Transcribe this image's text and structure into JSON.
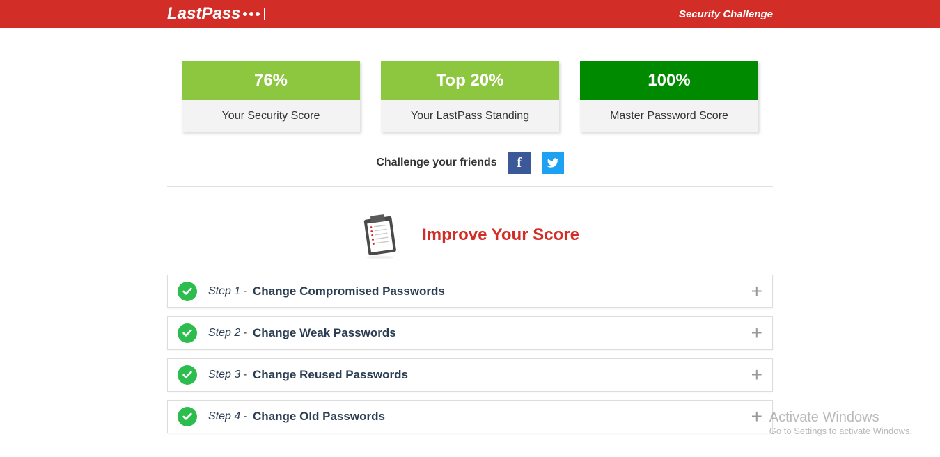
{
  "header": {
    "logo_text": "LastPass",
    "title": "Security Challenge"
  },
  "scores": [
    {
      "value": "76%",
      "label": "Your Security Score",
      "color": "light"
    },
    {
      "value": "Top 20%",
      "label": "Your LastPass Standing",
      "color": "light"
    },
    {
      "value": "100%",
      "label": "Master Password Score",
      "color": "dark"
    }
  ],
  "challenge": {
    "text": "Challenge your friends"
  },
  "improve": {
    "title": "Improve Your Score"
  },
  "steps": [
    {
      "prefix": "Step 1 -",
      "title": "Change Compromised Passwords"
    },
    {
      "prefix": "Step 2 -",
      "title": "Change Weak Passwords"
    },
    {
      "prefix": "Step 3 -",
      "title": "Change Reused Passwords"
    },
    {
      "prefix": "Step 4 -",
      "title": "Change Old Passwords"
    }
  ],
  "watermark": {
    "title": "Activate Windows",
    "sub": "Go to Settings to activate Windows."
  }
}
